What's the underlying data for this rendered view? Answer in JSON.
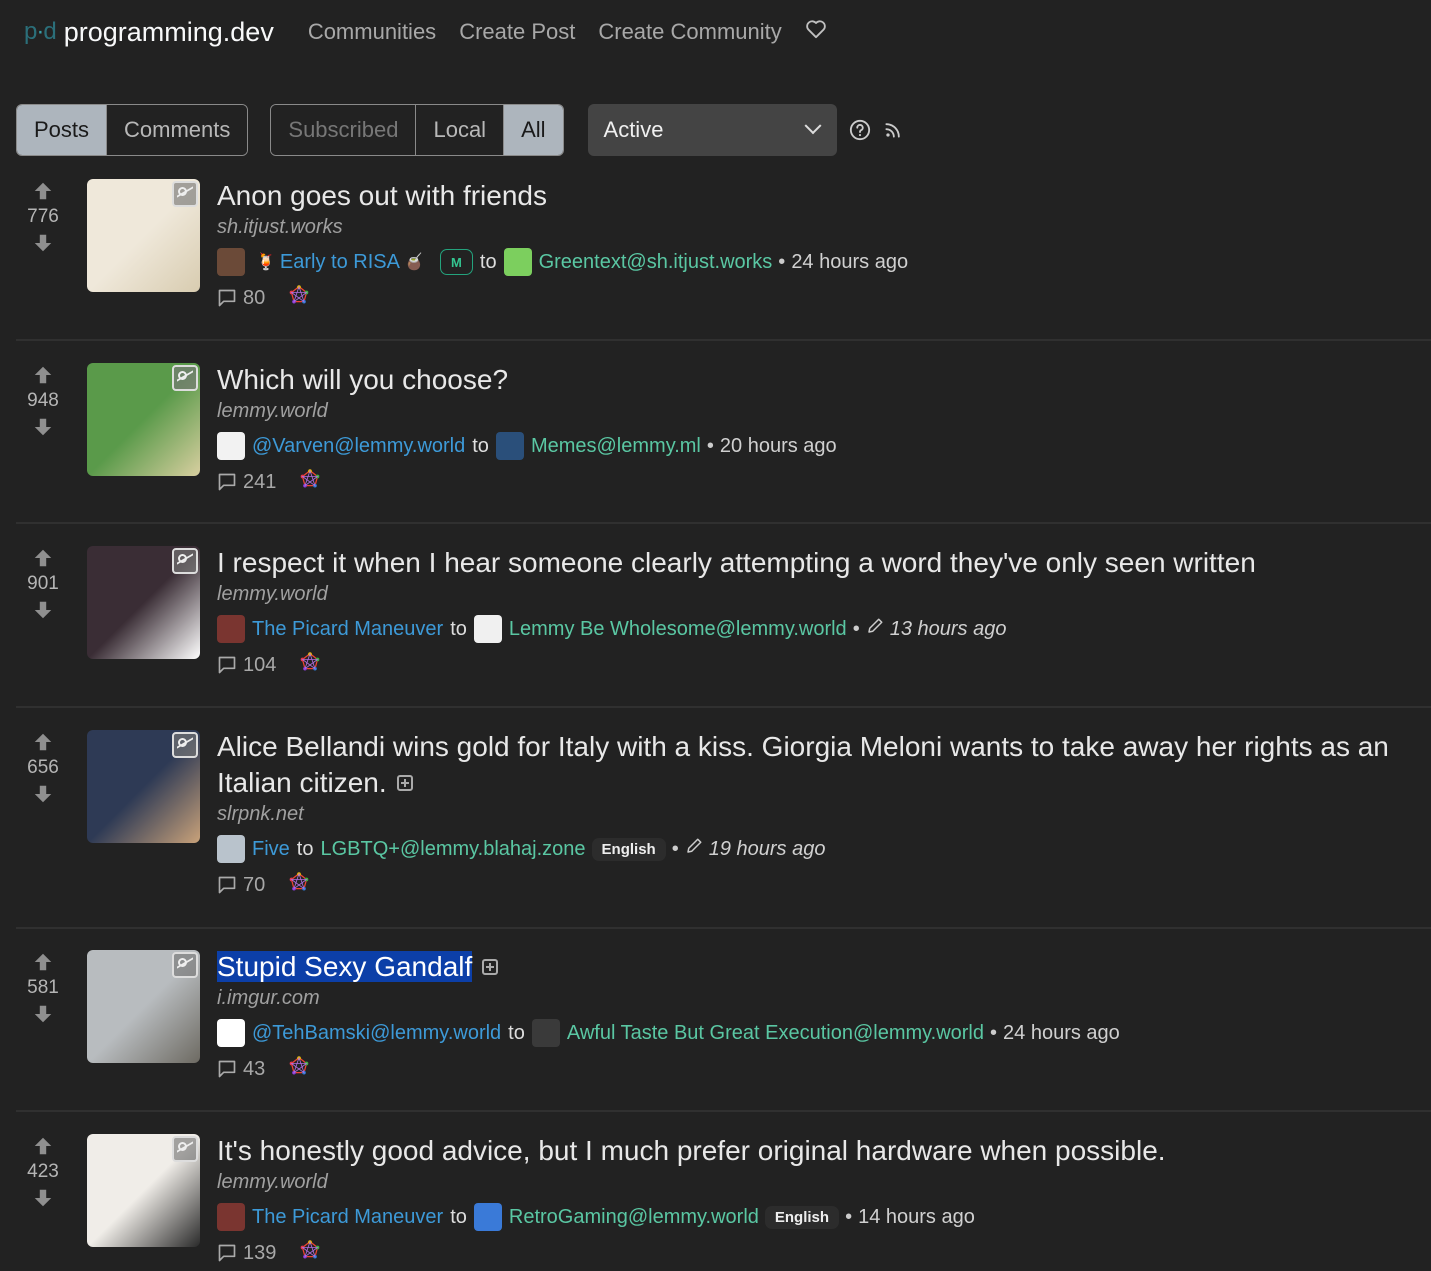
{
  "navbar": {
    "logo_text": "p·d",
    "site_name": "programming.dev",
    "links": [
      "Communities",
      "Create Post",
      "Create Community"
    ],
    "donate_icon": "heart-icon"
  },
  "toolbar": {
    "type_tabs": [
      {
        "label": "Posts",
        "active": true
      },
      {
        "label": "Comments",
        "active": false
      }
    ],
    "listing_tabs": [
      {
        "label": "Subscribed",
        "active": false
      },
      {
        "label": "Local",
        "active": false
      },
      {
        "label": "All",
        "active": true
      }
    ],
    "sort": {
      "selected": "Active"
    },
    "help_icon": "question-circle-icon",
    "rss_icon": "rss-icon"
  },
  "posts": [
    {
      "score": "776",
      "title": "Anon goes out with friends",
      "domain": "sh.itjust.works",
      "user": "Early to RISA",
      "user_prefix_emoji": "🍹",
      "user_suffix_emoji": "🧉",
      "mod_badge": "M",
      "to": "to",
      "community": "Greentext@sh.itjust.works",
      "time": "24 hours ago",
      "comments": "80",
      "thumb_colors": [
        "#efe8da",
        "#d8ccb0"
      ],
      "user_avatar_color": "#6b4a38",
      "community_avatar_color": "#7ccf5e"
    },
    {
      "score": "948",
      "title": "Which will you choose?",
      "domain": "lemmy.world",
      "user": "@Varven@lemmy.world",
      "to": "to",
      "community": "Memes@lemmy.ml",
      "time": "20 hours ago",
      "comments": "241",
      "thumb_colors": [
        "#5a9a4a",
        "#d8cfa0"
      ],
      "user_avatar_color": "#f2f2f2",
      "community_avatar_color": "#2a4f7a"
    },
    {
      "score": "901",
      "title": "I respect it when I hear someone clearly attempting a word they've only seen written",
      "domain": "lemmy.world",
      "user": "The Picard Maneuver",
      "to": "to",
      "community": "Lemmy Be Wholesome@lemmy.world",
      "time": "13 hours ago",
      "edited": true,
      "comments": "104",
      "thumb_colors": [
        "#3a2d35",
        "#ffffff"
      ],
      "user_avatar_color": "#7a3530",
      "community_avatar_color": "#f0f0f0"
    },
    {
      "score": "656",
      "title": "Alice Bellandi wins gold for Italy with a kiss. Giorgia Meloni wants to take away her rights as an Italian citizen.",
      "domain": "slrpnk.net",
      "user": "Five",
      "to": "to",
      "community": "LGBTQ+@lemmy.blahaj.zone",
      "language": "English",
      "time": "19 hours ago",
      "edited": true,
      "has_body": true,
      "comments": "70",
      "thumb_colors": [
        "#2e3a55",
        "#c9a27a"
      ],
      "user_avatar_color": "#b9c3cc"
    },
    {
      "score": "581",
      "title": "Stupid Sexy Gandalf",
      "title_selected": true,
      "domain": "i.imgur.com",
      "user": "@TehBamski@lemmy.world",
      "to": "to",
      "community": "Awful Taste But Great Execution@lemmy.world",
      "time": "24 hours ago",
      "has_body": true,
      "comments": "43",
      "thumb_colors": [
        "#b8bcbf",
        "#6d6a62"
      ],
      "user_avatar_color": "#ffffff",
      "community_avatar_color": "#3a3a3a"
    },
    {
      "score": "423",
      "title": "It's honestly good advice, but I much prefer original hardware when possible.",
      "domain": "lemmy.world",
      "user": "The Picard Maneuver",
      "to": "to",
      "community": "RetroGaming@lemmy.world",
      "language": "English",
      "time": "14 hours ago",
      "comments": "139",
      "thumb_colors": [
        "#f0ede8",
        "#2a2a2a"
      ],
      "user_avatar_color": "#7a3530",
      "community_avatar_color": "#3a7ad8"
    }
  ]
}
